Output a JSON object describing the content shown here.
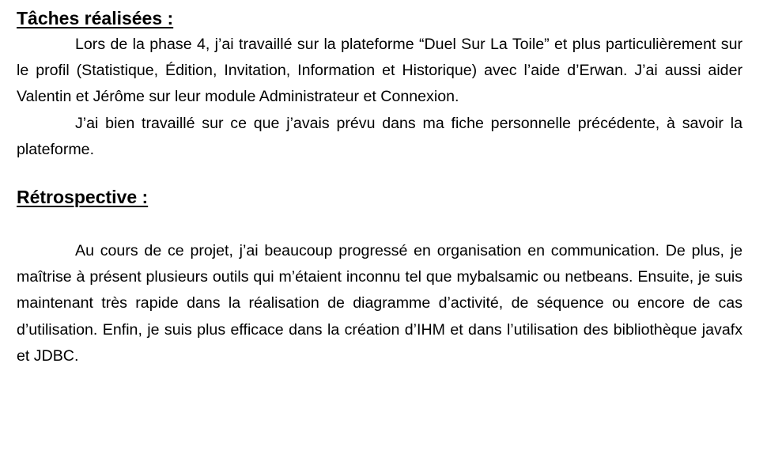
{
  "document": {
    "sections": [
      {
        "heading": "Tâches réalisées :",
        "paragraphs": [
          "Lors de la phase 4, j’ai travaillé sur la plateforme “Duel Sur La Toile” et plus particulièrement sur le profil (Statistique, Édition, Invitation, Information et Historique) avec l’aide d’Erwan. J’ai aussi aider Valentin et Jérôme sur leur module Administrateur et Connexion.",
          "J’ai bien travaillé sur ce que j’avais prévu dans ma fiche personnelle précédente, à savoir la plateforme."
        ]
      },
      {
        "heading": "Rétrospective :",
        "paragraphs": [
          "Au cours de ce projet, j’ai beaucoup progressé en organisation en communication. De plus, je maîtrise à présent plusieurs outils qui m’étaient inconnu tel que mybalsamic ou netbeans. Ensuite, je suis maintenant très rapide dans la réalisation de diagramme d’activité, de séquence ou encore de cas d’utilisation. Enfin, je suis plus efficace dans la création d’IHM et dans l’utilisation des bibliothèque javafx et JDBC."
        ]
      }
    ]
  }
}
